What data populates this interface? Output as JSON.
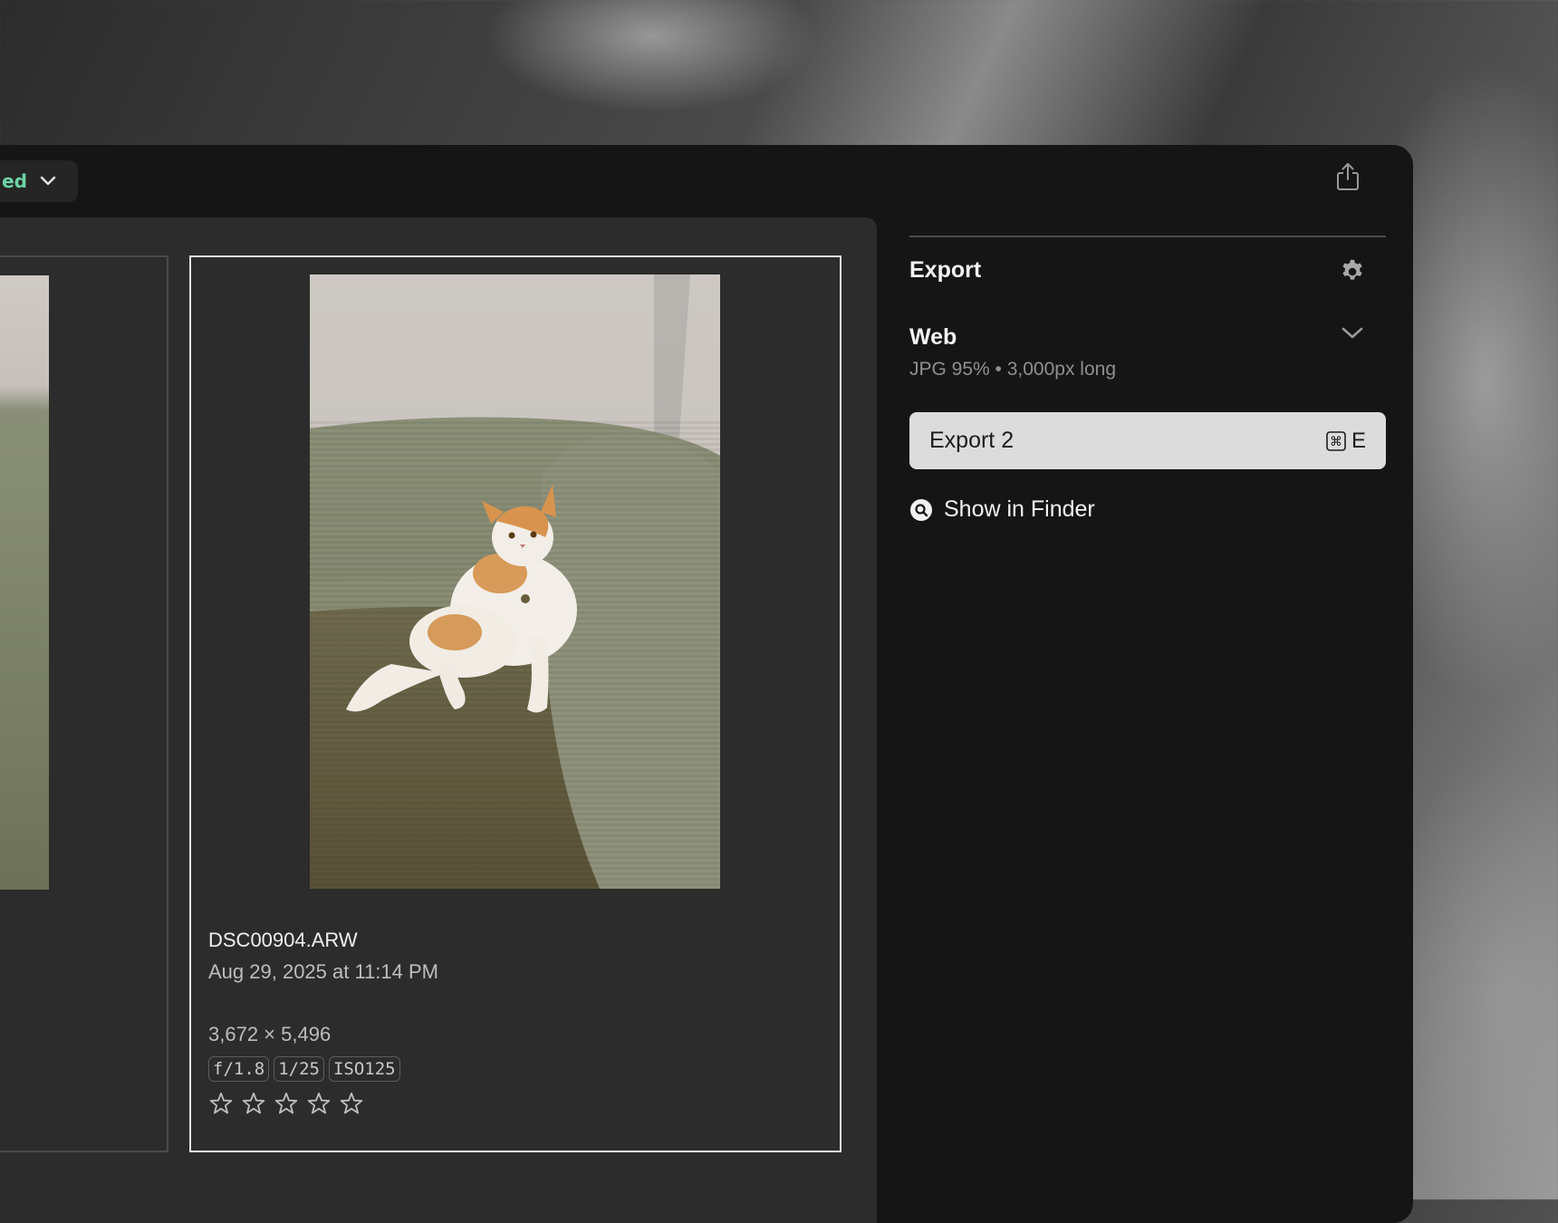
{
  "toolbar": {
    "filter_label": "ed",
    "share_icon": "share-icon"
  },
  "photo": {
    "filename": "DSC00904.ARW",
    "date": "Aug 29, 2025 at 11:14 PM",
    "dimensions": "3,672 × 5,496",
    "exif": [
      "f/1.8",
      "1/25",
      "ISO125"
    ],
    "rating": 0,
    "max_rating": 5
  },
  "export_panel": {
    "title": "Export",
    "preset_name": "Web",
    "preset_description": "JPG 95% • 3,000px long",
    "export_button_label": "Export 2",
    "shortcut_key": "E",
    "shortcut_modifier": "⌘",
    "show_in_finder": "Show in Finder"
  }
}
